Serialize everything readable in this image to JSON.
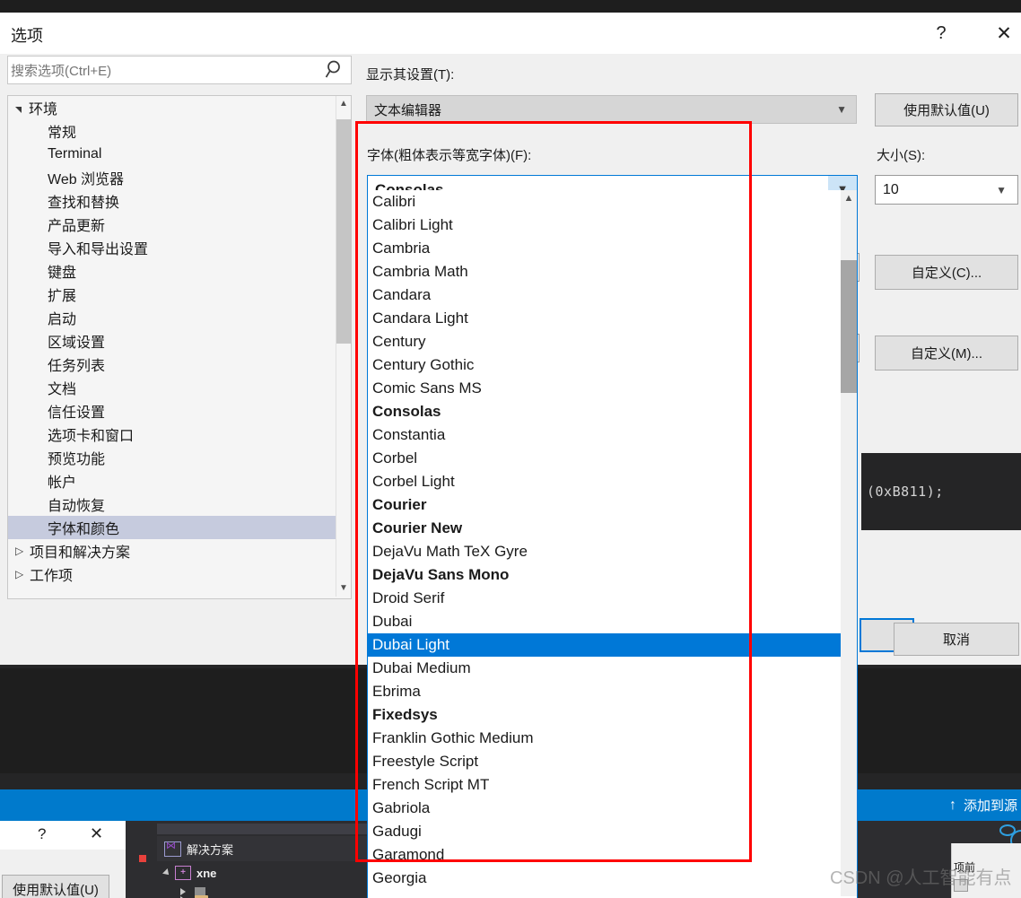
{
  "window": {
    "title": "选项",
    "help_label": "?",
    "close_label": "✕"
  },
  "search": {
    "placeholder": "搜索选项(Ctrl+E)",
    "value": "",
    "icon": "search-icon"
  },
  "tree": {
    "items": [
      {
        "label": "环境",
        "level": 0,
        "expander": "open",
        "selected": false
      },
      {
        "label": "常规",
        "level": 1,
        "expander": "none",
        "selected": false
      },
      {
        "label": "Terminal",
        "level": 1,
        "expander": "none",
        "selected": false
      },
      {
        "label": "Web 浏览器",
        "level": 1,
        "expander": "none",
        "selected": false
      },
      {
        "label": "查找和替换",
        "level": 1,
        "expander": "none",
        "selected": false
      },
      {
        "label": "产品更新",
        "level": 1,
        "expander": "none",
        "selected": false
      },
      {
        "label": "导入和导出设置",
        "level": 1,
        "expander": "none",
        "selected": false
      },
      {
        "label": "键盘",
        "level": 1,
        "expander": "none",
        "selected": false
      },
      {
        "label": "扩展",
        "level": 1,
        "expander": "none",
        "selected": false
      },
      {
        "label": "启动",
        "level": 1,
        "expander": "none",
        "selected": false
      },
      {
        "label": "区域设置",
        "level": 1,
        "expander": "none",
        "selected": false
      },
      {
        "label": "任务列表",
        "level": 1,
        "expander": "none",
        "selected": false
      },
      {
        "label": "文档",
        "level": 1,
        "expander": "none",
        "selected": false
      },
      {
        "label": "信任设置",
        "level": 1,
        "expander": "none",
        "selected": false
      },
      {
        "label": "选项卡和窗口",
        "level": 1,
        "expander": "none",
        "selected": false
      },
      {
        "label": "预览功能",
        "level": 1,
        "expander": "none",
        "selected": false
      },
      {
        "label": "帐户",
        "level": 1,
        "expander": "none",
        "selected": false
      },
      {
        "label": "自动恢复",
        "level": 1,
        "expander": "none",
        "selected": false
      },
      {
        "label": "字体和颜色",
        "level": 1,
        "expander": "none",
        "selected": true
      },
      {
        "label": "项目和解决方案",
        "level": 0,
        "expander": "closed",
        "selected": false
      },
      {
        "label": "工作项",
        "level": 0,
        "expander": "closed",
        "selected": false
      }
    ],
    "scroll_up_icon": "chevron-up-icon",
    "scroll_down_icon": "chevron-down-icon"
  },
  "settings_panel": {
    "show_settings_for_label": "显示其设置(T):",
    "show_settings_for_value": "文本编辑器",
    "use_defaults_button": "使用默认值(U)",
    "font_label": "字体(粗体表示等宽字体)(F):",
    "font_value": "Consolas",
    "size_label": "大小(S):",
    "size_value": "10",
    "custom_c_button": "自定义(C)...",
    "custom_m_button": "自定义(M)...",
    "preview_code": "(0xB811);",
    "ok_button": "",
    "cancel_button": "取消"
  },
  "font_dropdown": {
    "items": [
      {
        "name": "Calibri",
        "bold": false,
        "selected": false
      },
      {
        "name": "Calibri Light",
        "bold": false,
        "selected": false
      },
      {
        "name": "Cambria",
        "bold": false,
        "selected": false
      },
      {
        "name": "Cambria Math",
        "bold": false,
        "selected": false
      },
      {
        "name": "Candara",
        "bold": false,
        "selected": false
      },
      {
        "name": "Candara Light",
        "bold": false,
        "selected": false
      },
      {
        "name": "Century",
        "bold": false,
        "selected": false
      },
      {
        "name": "Century Gothic",
        "bold": false,
        "selected": false
      },
      {
        "name": "Comic Sans MS",
        "bold": false,
        "selected": false
      },
      {
        "name": "Consolas",
        "bold": true,
        "selected": false
      },
      {
        "name": "Constantia",
        "bold": false,
        "selected": false
      },
      {
        "name": "Corbel",
        "bold": false,
        "selected": false
      },
      {
        "name": "Corbel Light",
        "bold": false,
        "selected": false
      },
      {
        "name": "Courier",
        "bold": true,
        "selected": false
      },
      {
        "name": "Courier New",
        "bold": true,
        "selected": false
      },
      {
        "name": "DejaVu Math TeX Gyre",
        "bold": false,
        "selected": false
      },
      {
        "name": "DejaVu Sans Mono",
        "bold": true,
        "selected": false
      },
      {
        "name": "Droid Serif",
        "bold": false,
        "selected": false
      },
      {
        "name": "Dubai",
        "bold": false,
        "selected": false
      },
      {
        "name": "Dubai Light",
        "bold": false,
        "selected": true
      },
      {
        "name": "Dubai Medium",
        "bold": false,
        "selected": false
      },
      {
        "name": "Ebrima",
        "bold": false,
        "selected": false
      },
      {
        "name": "Fixedsys",
        "bold": true,
        "selected": false
      },
      {
        "name": "Franklin Gothic Medium",
        "bold": false,
        "selected": false
      },
      {
        "name": "Freestyle Script",
        "bold": false,
        "selected": false
      },
      {
        "name": "French Script MT",
        "bold": false,
        "selected": false
      },
      {
        "name": "Gabriola",
        "bold": false,
        "selected": false
      },
      {
        "name": "Gadugi",
        "bold": false,
        "selected": false
      },
      {
        "name": "Garamond",
        "bold": false,
        "selected": false
      },
      {
        "name": "Georgia",
        "bold": false,
        "selected": false
      }
    ],
    "scroll_up_icon": "chevron-up-icon"
  },
  "ide_background": {
    "statusbar_text": "添加到源",
    "statusbar_icon": "up-arrow-icon",
    "solution_explorer_title": "解决方案",
    "project_name": "xne",
    "properties_label": "项前",
    "mini_dialog": {
      "help_label": "?",
      "close_label": "✕",
      "use_defaults_button": "使用默认值(U)"
    }
  },
  "watermark": {
    "text": "CSDN @人工智能有点"
  },
  "colors": {
    "accent_blue": "#0078d7",
    "statusbar_blue": "#007acc",
    "selection_blue": "#0078d7",
    "tree_selection": "#c6cbde",
    "annotation_red": "#ff0000",
    "dialog_bg": "#f0f0f0",
    "editor_bg": "#1e1e1e",
    "ribbon_red": "#e8413c"
  }
}
